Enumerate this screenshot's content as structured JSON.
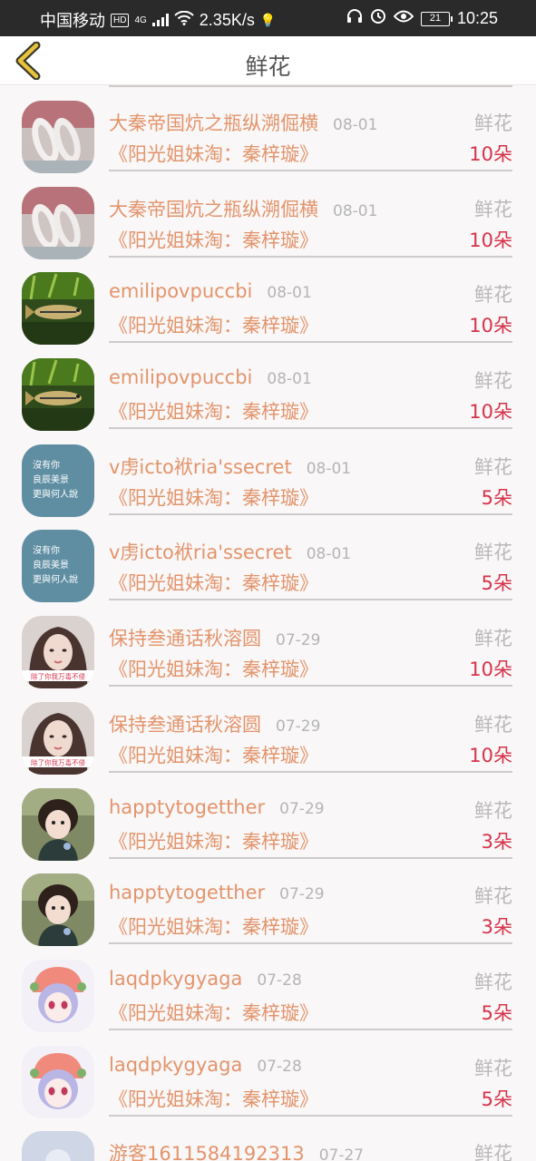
{
  "status_bar": {
    "carrier": "中国移动",
    "hd": "HD",
    "network": "4G",
    "speed": "2.35K/s",
    "battery": "21",
    "time": "10:25"
  },
  "header": {
    "title": "鲜花",
    "back_icon": "chevron-left-icon"
  },
  "colors": {
    "name": "#e3946c",
    "count": "#d6334a",
    "muted": "#b5b5b5"
  },
  "items": [
    {
      "name": "大秦帝国炕之瓶纵溯倔横",
      "date": "08-01",
      "gift": "鲜花",
      "target": "《阳光姐妹淘：秦梓璇》",
      "count": "10朵",
      "avatar": "food"
    },
    {
      "name": "大秦帝国炕之瓶纵溯倔横",
      "date": "08-01",
      "gift": "鲜花",
      "target": "《阳光姐妹淘：秦梓璇》",
      "count": "10朵",
      "avatar": "food"
    },
    {
      "name": "emilipovpuccbi",
      "date": "08-01",
      "gift": "鲜花",
      "target": "《阳光姐妹淘：秦梓璇》",
      "count": "10朵",
      "avatar": "fish"
    },
    {
      "name": "emilipovpuccbi",
      "date": "08-01",
      "gift": "鲜花",
      "target": "《阳光姐妹淘：秦梓璇》",
      "count": "10朵",
      "avatar": "fish"
    },
    {
      "name": "v虏icto袱ria'ssecret",
      "date": "08-01",
      "gift": "鲜花",
      "target": "《阳光姐妹淘：秦梓璇》",
      "count": "5朵",
      "avatar": "text",
      "avatar_text": [
        "沒有你",
        "良辰美景",
        "更與何人說"
      ]
    },
    {
      "name": "v虏icto袱ria'ssecret",
      "date": "08-01",
      "gift": "鲜花",
      "target": "《阳光姐妹淘：秦梓璇》",
      "count": "5朵",
      "avatar": "text",
      "avatar_text": [
        "沒有你",
        "良辰美景",
        "更與何人說"
      ]
    },
    {
      "name": "保持叁通话秋溶圆",
      "date": "07-29",
      "gift": "鲜花",
      "target": "《阳光姐妹淘：秦梓璇》",
      "count": "10朵",
      "avatar": "girl",
      "avatar_caption": "除了你我万毒不侵"
    },
    {
      "name": "保持叁通话秋溶圆",
      "date": "07-29",
      "gift": "鲜花",
      "target": "《阳光姐妹淘：秦梓璇》",
      "count": "10朵",
      "avatar": "girl",
      "avatar_caption": "除了你我万毒不侵"
    },
    {
      "name": "happtytogetther",
      "date": "07-29",
      "gift": "鲜花",
      "target": "《阳光姐妹淘：秦梓璇》",
      "count": "3朵",
      "avatar": "child"
    },
    {
      "name": "happtytogetther",
      "date": "07-29",
      "gift": "鲜花",
      "target": "《阳光姐妹淘：秦梓璇》",
      "count": "3朵",
      "avatar": "child"
    },
    {
      "name": "laqdpkygyaga",
      "date": "07-28",
      "gift": "鲜花",
      "target": "《阳光姐妹淘：秦梓璇》",
      "count": "5朵",
      "avatar": "anime"
    },
    {
      "name": "laqdpkygyaga",
      "date": "07-28",
      "gift": "鲜花",
      "target": "《阳光姐妹淘：秦梓璇》",
      "count": "5朵",
      "avatar": "anime"
    },
    {
      "name": "游客1611584192313",
      "date": "07-27",
      "gift": "鲜花",
      "target": "",
      "count": "",
      "avatar": "guest"
    }
  ]
}
